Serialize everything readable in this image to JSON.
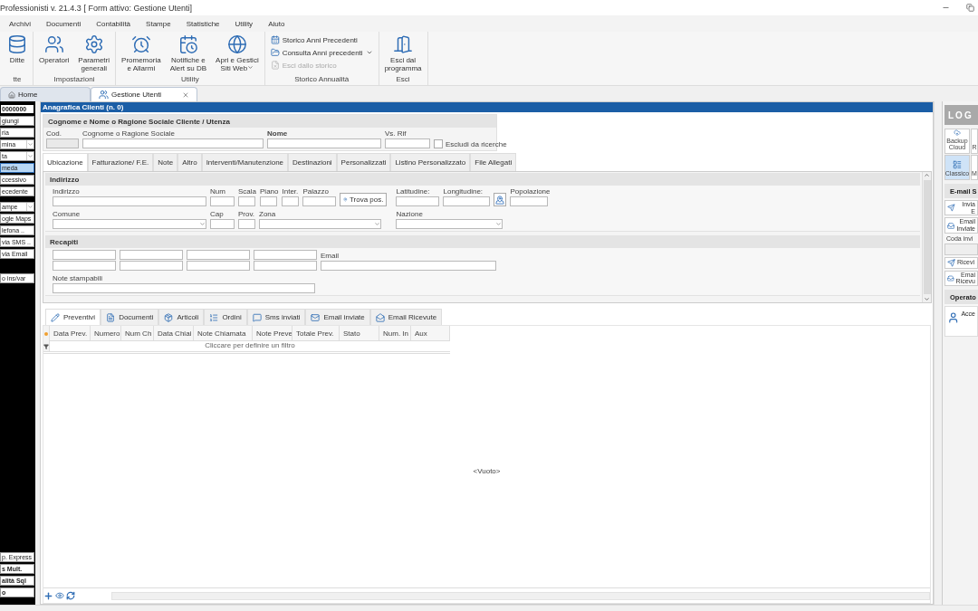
{
  "window": {
    "title": "Professionisti v. 21.4.3 [ Form attivo: Gestione Utenti]"
  },
  "menu": [
    {
      "label": "Archivi"
    },
    {
      "label": "Documenti"
    },
    {
      "label": "Contabilità"
    },
    {
      "label": "Stampe"
    },
    {
      "label": "Statistiche"
    },
    {
      "label": "Utility"
    },
    {
      "label": "Aiuto"
    }
  ],
  "ribbon": [
    {
      "label": "tte",
      "items": [
        {
          "kind": "large",
          "label": "Ditte",
          "dropdown": false,
          "disabled": false
        }
      ]
    },
    {
      "label": "Impostazioni",
      "items": [
        {
          "kind": "large",
          "label": "Operatori",
          "dropdown": false,
          "disabled": false
        },
        {
          "kind": "large",
          "label": "Parametri\ngenerali",
          "dropdown": false,
          "disabled": false
        }
      ]
    },
    {
      "label": "Utility",
      "items": [
        {
          "kind": "large",
          "label": "Promemoria\ne Allarmi",
          "dropdown": false,
          "disabled": false
        },
        {
          "kind": "large",
          "label": "Notifiche e\nAlert su DB",
          "dropdown": false,
          "disabled": false
        },
        {
          "kind": "large",
          "label": "Apri e Gestici\nSiti Web",
          "dropdown": true,
          "disabled": false
        }
      ]
    },
    {
      "label": "Storico Annualità",
      "items": [
        {
          "kind": "small",
          "label": "Storico Anni Precedenti",
          "dropdown": false,
          "disabled": false
        },
        {
          "kind": "small",
          "label": "Consulta Anni precedenti",
          "dropdown": true,
          "disabled": false
        },
        {
          "kind": "small",
          "label": "Esci dallo storico",
          "dropdown": false,
          "disabled": true
        }
      ]
    },
    {
      "label": "Esci",
      "items": [
        {
          "kind": "large",
          "label": "Esci dal\nprogramma",
          "dropdown": false,
          "disabled": false
        }
      ]
    }
  ],
  "doc_tabs": [
    {
      "label": "Home",
      "selected": false,
      "closable": false
    },
    {
      "label": "Gestione Utenti",
      "selected": true,
      "closable": true
    }
  ],
  "sidebar": {
    "top_groups": [
      [
        {
          "kind": "field",
          "label": "0000000"
        },
        {
          "kind": "button",
          "label": "giungi",
          "selected": false
        },
        {
          "kind": "button",
          "label": "ria",
          "selected": false
        },
        {
          "kind": "dropdown",
          "label": "mina",
          "selected": false
        },
        {
          "kind": "dropdown",
          "label": "ta",
          "selected": false
        },
        {
          "kind": "button",
          "label": "meda",
          "selected": true
        },
        {
          "kind": "button",
          "label": "ccessivo",
          "selected": false
        },
        {
          "kind": "button",
          "label": "ecedente",
          "selected": false
        }
      ],
      [
        {
          "kind": "dropdown",
          "label": "ampe",
          "selected": false
        },
        {
          "kind": "button",
          "label": "ogle Maps",
          "selected": false
        },
        {
          "kind": "button",
          "label": "lefona ..",
          "selected": false
        },
        {
          "kind": "button",
          "label": "via SMS ..",
          "selected": false
        },
        {
          "kind": "button",
          "label": "via Email",
          "selected": false
        }
      ],
      [
        {
          "kind": "button",
          "label": "o ins/var",
          "selected": false
        }
      ]
    ],
    "bottom_group": [
      {
        "kind": "button",
        "label": "p. Express",
        "bold": false
      },
      {
        "kind": "button",
        "label": "s Mult.",
        "bold": true
      },
      {
        "kind": "button",
        "label": "alità Sql",
        "bold": true
      },
      {
        "kind": "button",
        "label": "o",
        "bold": true
      }
    ]
  },
  "form": {
    "title": "Anagrafica Clienti (n. 0)",
    "identity": {
      "title": "Cognome e Nome o Ragione Sociale Cliente / Utenza",
      "fields": [
        {
          "kind": "text",
          "label": "Cod.",
          "bold": false,
          "disabled": true
        },
        {
          "kind": "text",
          "label": "Cognome o Ragione Sociale",
          "bold": false,
          "disabled": false
        },
        {
          "kind": "text",
          "label": "Nome",
          "bold": true,
          "disabled": false
        },
        {
          "kind": "text",
          "label": "Vs. Rif",
          "bold": false,
          "disabled": false
        },
        {
          "kind": "checkbox",
          "label": "Escludi da ricerche",
          "checked": false
        }
      ]
    },
    "tabs": [
      {
        "label": "Ubicazione",
        "selected": true
      },
      {
        "label": "Fatturazione/ F.E.",
        "selected": false
      },
      {
        "label": "Note",
        "selected": false
      },
      {
        "label": "Altro",
        "selected": false
      },
      {
        "label": "Interventi/Manutenzione",
        "selected": false
      },
      {
        "label": "Destinazioni",
        "selected": false
      },
      {
        "label": "Personalizzati",
        "selected": false
      },
      {
        "label": "Listino Personalizzato",
        "selected": false
      },
      {
        "label": "File Allegati",
        "selected": false
      }
    ],
    "sections": [
      {
        "title": "Indirizzo",
        "blocks": [
          {
            "rows": [
              [
                {
                  "kind": "text",
                  "label": "Indirizzo"
                },
                {
                  "kind": "text",
                  "label": "Num"
                },
                {
                  "kind": "text",
                  "label": "Scala"
                },
                {
                  "kind": "text",
                  "label": "Piano"
                },
                {
                  "kind": "text",
                  "label": "Inter."
                },
                {
                  "kind": "text",
                  "label": "Palazzo"
                },
                {
                  "kind": "button",
                  "label": "Trova pos."
                }
              ],
              [
                {
                  "kind": "combo",
                  "label": "Comune"
                },
                {
                  "kind": "text",
                  "label": "Cap"
                },
                {
                  "kind": "text",
                  "label": "Prov."
                },
                {
                  "kind": "combo",
                  "label": "Zona"
                }
              ]
            ]
          },
          {
            "rows": [
              [
                {
                  "kind": "text",
                  "label": "Latitudine:"
                },
                {
                  "kind": "text",
                  "label": "Longitudine:"
                },
                {
                  "kind": "icon_button"
                },
                {
                  "kind": "text",
                  "label": "Popolazione"
                }
              ],
              [
                {
                  "kind": "combo",
                  "label": "Nazione"
                }
              ]
            ]
          }
        ]
      },
      {
        "title": "Recapiti",
        "blocks": [
          {
            "rows": [
              [
                {
                  "kind": "pair"
                },
                {
                  "kind": "pair"
                },
                {
                  "kind": "pair"
                },
                {
                  "kind": "pair"
                },
                {
                  "kind": "text",
                  "label": "Email"
                }
              ],
              [
                {
                  "kind": "text",
                  "label": "Note stampabili"
                }
              ]
            ]
          }
        ]
      }
    ]
  },
  "detail": {
    "tabs": [
      {
        "label": "Preventivi",
        "selected": true
      },
      {
        "label": "Documenti",
        "selected": false
      },
      {
        "label": "Articoli",
        "selected": false
      },
      {
        "label": "Ordini",
        "selected": false
      },
      {
        "label": "Sms inviati",
        "selected": false
      },
      {
        "label": "Email inviate",
        "selected": false
      },
      {
        "label": "Email Ricevute",
        "selected": false
      }
    ],
    "columns": [
      "Data Prev.",
      "Numero",
      "Num Ch",
      "Data Chiai",
      "Note Chiamata",
      "Note Preve",
      "Totale Prev.",
      "Stato",
      "Num. In",
      "Aux"
    ],
    "filter_hint": "Cliccare per definire un filtro",
    "empty": "<Vuoto>"
  },
  "side_panel": {
    "logo": "LOG",
    "buttons": [
      {
        "label": "Backup\nCloud",
        "selected": false
      },
      {
        "label": "R",
        "selected": false
      },
      {
        "label": "Classico",
        "selected": true
      },
      {
        "label": "M",
        "selected": false
      }
    ],
    "email": {
      "title": "E-mail S",
      "items": [
        {
          "kind": "button",
          "label": "Invia E"
        },
        {
          "kind": "button",
          "label": "Email\nInviate"
        },
        {
          "kind": "label",
          "label": "Coda invi"
        },
        {
          "kind": "field"
        },
        {
          "kind": "button",
          "label": "Ricevi"
        },
        {
          "kind": "button",
          "label": "Emai\nRicevu"
        }
      ]
    },
    "operators": {
      "title": "Operato",
      "items": [
        {
          "label": "Acce"
        }
      ]
    }
  }
}
